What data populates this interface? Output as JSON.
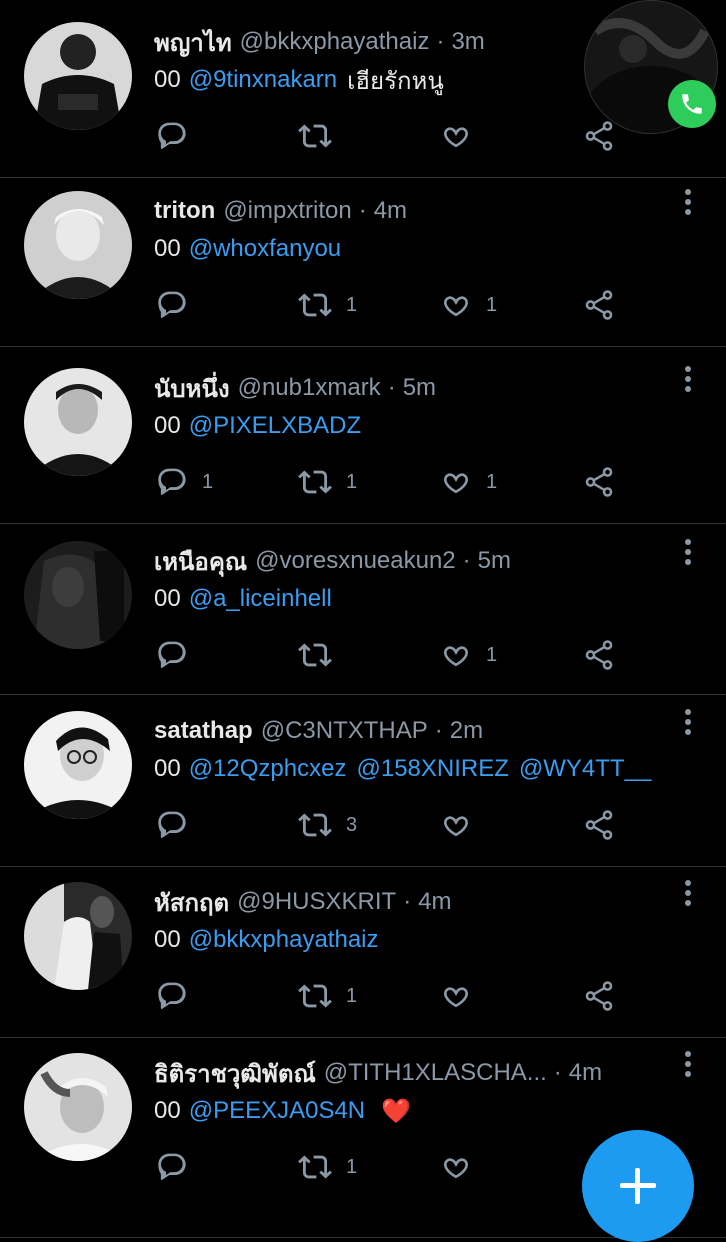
{
  "tweets": [
    {
      "name": "พญาไท",
      "handle": "@bkkxphayathaiz",
      "time": "3m",
      "pre": "00",
      "mentions": [
        "@9tinxnakarn"
      ],
      "text": "เฮียรักหนู",
      "emoji": "",
      "reply_count": "",
      "retweet_count": "",
      "like_count": "",
      "avatar_icon": "avatar-person-black-tee"
    },
    {
      "name": "triton",
      "handle": "@impxtriton",
      "time": "4m",
      "pre": "00",
      "mentions": [
        "@whoxfanyou"
      ],
      "text": "",
      "emoji": "",
      "reply_count": "",
      "retweet_count": "1",
      "like_count": "1",
      "avatar_icon": "avatar-person-light-hair"
    },
    {
      "name": "นับหนึ่ง",
      "handle": "@nub1xmark",
      "time": "5m",
      "pre": "00",
      "mentions": [
        "@PIXELXBADZ"
      ],
      "text": "",
      "emoji": "",
      "reply_count": "1",
      "retweet_count": "1",
      "like_count": "1",
      "avatar_icon": "avatar-person-dark"
    },
    {
      "name": "เหนือคุณ",
      "handle": "@voresxnueakun2",
      "time": "5m",
      "pre": "00",
      "mentions": [
        "@a_liceinhell"
      ],
      "text": "",
      "emoji": "",
      "reply_count": "",
      "retweet_count": "",
      "like_count": "1",
      "avatar_icon": "avatar-person-shadow"
    },
    {
      "name": "satathap",
      "handle": "@C3NTXTHAP",
      "time": "2m",
      "pre": "00",
      "mentions": [
        "@12Qzphcxez",
        "@158XNIREZ",
        "@WY4TT__"
      ],
      "text": "",
      "emoji": "",
      "reply_count": "",
      "retweet_count": "3",
      "like_count": "",
      "avatar_icon": "avatar-person-glasses"
    },
    {
      "name": "หัสกฤต",
      "handle": "@9HUSXKRIT",
      "time": "4m",
      "pre": "00",
      "mentions": [
        "@bkkxphayathaiz"
      ],
      "text": "",
      "emoji": "",
      "reply_count": "",
      "retweet_count": "1",
      "like_count": "",
      "avatar_icon": "avatar-person-white-shirt"
    },
    {
      "name": "ธิติราชวุฒิพัตณ์",
      "handle": "@TITH1XLASCHA...",
      "time": "4m",
      "pre": "00",
      "mentions": [
        "@PEEXJA0S4N"
      ],
      "text": "",
      "emoji": "❤️",
      "reply_count": "",
      "retweet_count": "1",
      "like_count": "",
      "avatar_icon": "avatar-person-hand-hair"
    }
  ],
  "colors": {
    "background": "#000000",
    "mention": "#3a9df0",
    "muted": "#8b98a5",
    "fab": "#1d9bf0",
    "call": "#2ecc5b",
    "heart": "#e0245e"
  },
  "icons": {
    "reply": "reply-icon",
    "retweet": "retweet-icon",
    "like": "heart-icon",
    "share": "share-icon",
    "more": "more-vertical-icon",
    "call": "phone-icon",
    "compose": "plus-icon"
  }
}
